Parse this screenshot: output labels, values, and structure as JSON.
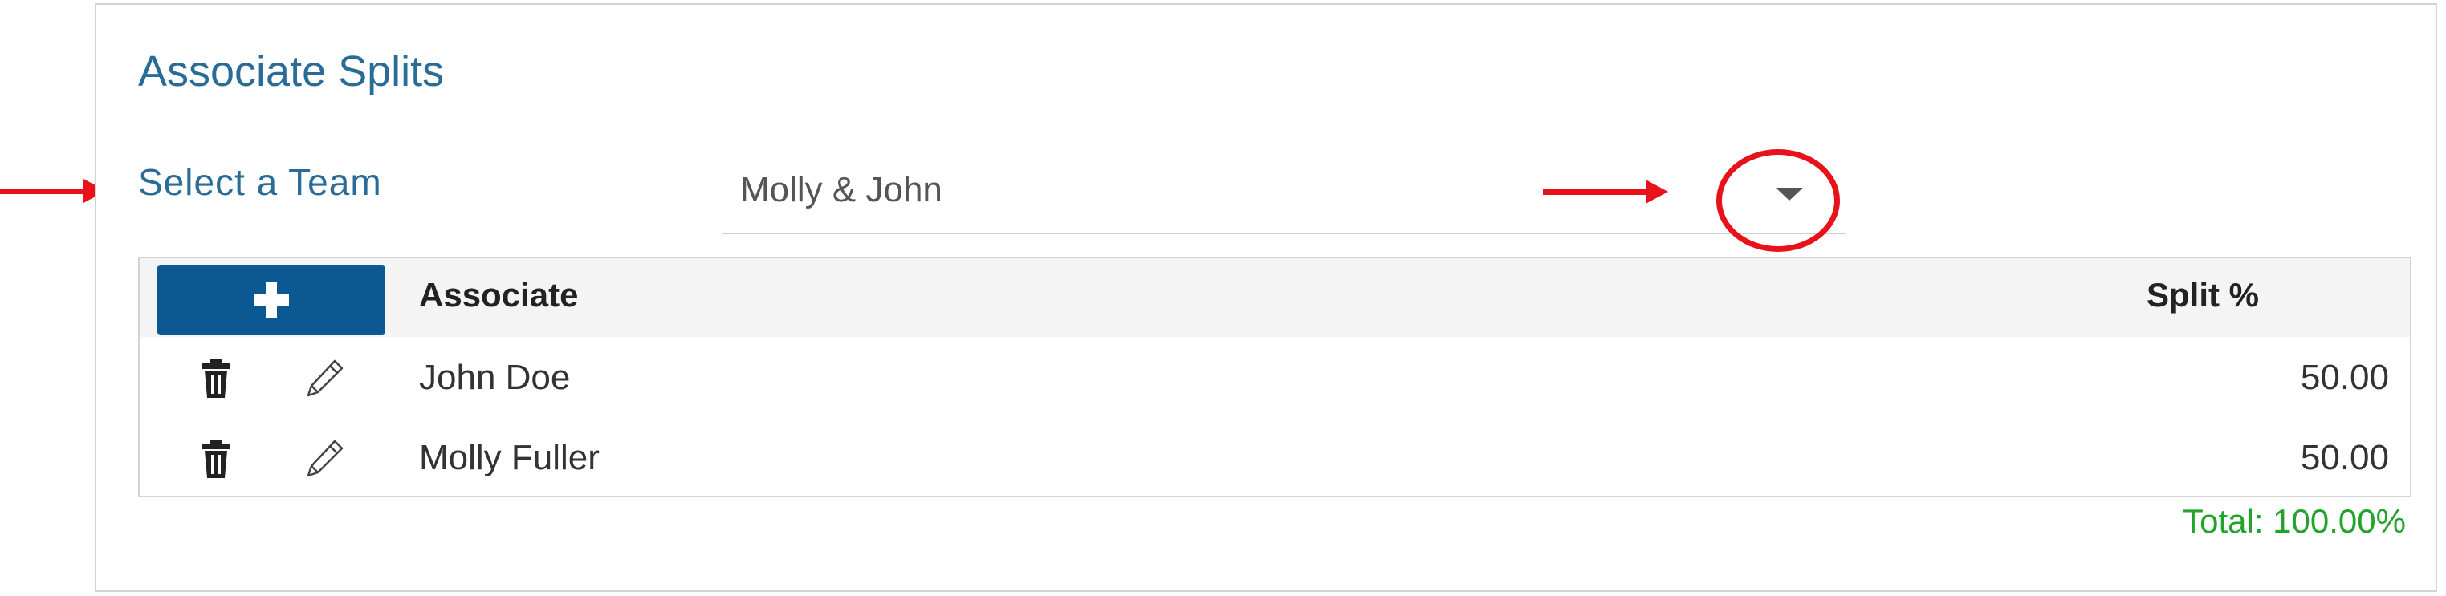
{
  "panel": {
    "title": "Associate Splits"
  },
  "team": {
    "label": "Select a Team",
    "selected": "Molly & John",
    "dropdown_icon": "caret-down-icon"
  },
  "grid": {
    "add_icon": "plus-icon",
    "columns": [
      "Associate",
      "Split %"
    ],
    "rows": [
      {
        "associate": "John Doe",
        "split": "50.00",
        "delete_icon": "trash-icon",
        "edit_icon": "pencil-icon"
      },
      {
        "associate": "Molly Fuller",
        "split": "50.00",
        "delete_icon": "trash-icon",
        "edit_icon": "pencil-icon"
      }
    ],
    "total": "Total: 100.00%"
  },
  "colors": {
    "title": "#2a6c98",
    "add_button": "#0c5893",
    "total": "#22a32a",
    "annotation": "#e8121b"
  }
}
